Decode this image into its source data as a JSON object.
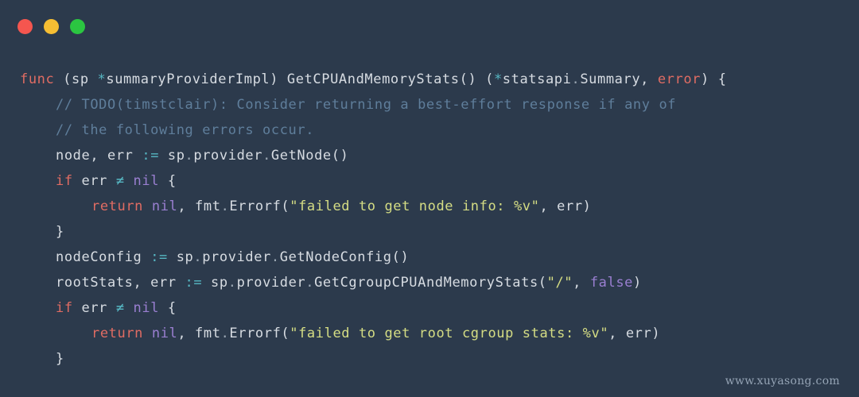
{
  "window": {
    "background_color": "#2c3a4c",
    "traffic_lights": [
      {
        "name": "close",
        "color": "#f5564f"
      },
      {
        "name": "minimize",
        "color": "#f6be33"
      },
      {
        "name": "maximize",
        "color": "#2bc641"
      }
    ]
  },
  "theme": {
    "keyword_color": "#e06c63",
    "plain_color": "#d7dce2",
    "operator_color": "#56b6c2",
    "constant_color": "#9a7fd1",
    "string_color": "#d5dd84",
    "comment_color": "#5f7e9b"
  },
  "code": {
    "language": "go",
    "lines": [
      {
        "indent": 0,
        "tokens": [
          {
            "t": "func",
            "c": "kw"
          },
          {
            "t": " (sp ",
            "c": "plain"
          },
          {
            "t": "*",
            "c": "op"
          },
          {
            "t": "summaryProviderImpl) GetCPUAndMemoryStats() (",
            "c": "plain"
          },
          {
            "t": "*",
            "c": "op"
          },
          {
            "t": "statsapi",
            "c": "plain"
          },
          {
            "t": ".",
            "c": "punct"
          },
          {
            "t": "Summary, ",
            "c": "plain"
          },
          {
            "t": "error",
            "c": "kw"
          },
          {
            "t": ") {",
            "c": "plain"
          }
        ]
      },
      {
        "indent": 1,
        "tokens": [
          {
            "t": "// TODO(timstclair): Consider returning a best-effort response if any of",
            "c": "comment"
          }
        ]
      },
      {
        "indent": 1,
        "tokens": [
          {
            "t": "// the following errors occur.",
            "c": "comment"
          }
        ]
      },
      {
        "indent": 1,
        "tokens": [
          {
            "t": "node, err ",
            "c": "plain"
          },
          {
            "t": ":=",
            "c": "op"
          },
          {
            "t": " sp",
            "c": "plain"
          },
          {
            "t": ".",
            "c": "punct"
          },
          {
            "t": "provider",
            "c": "plain"
          },
          {
            "t": ".",
            "c": "punct"
          },
          {
            "t": "GetNode()",
            "c": "plain"
          }
        ]
      },
      {
        "indent": 1,
        "tokens": [
          {
            "t": "if",
            "c": "kw"
          },
          {
            "t": " err ",
            "c": "plain"
          },
          {
            "t": "≠",
            "c": "op"
          },
          {
            "t": " ",
            "c": "plain"
          },
          {
            "t": "nil",
            "c": "const"
          },
          {
            "t": " {",
            "c": "plain"
          }
        ]
      },
      {
        "indent": 2,
        "tokens": [
          {
            "t": "return",
            "c": "kw"
          },
          {
            "t": " ",
            "c": "plain"
          },
          {
            "t": "nil",
            "c": "const"
          },
          {
            "t": ", fmt",
            "c": "plain"
          },
          {
            "t": ".",
            "c": "punct"
          },
          {
            "t": "Errorf(",
            "c": "plain"
          },
          {
            "t": "\"failed to get node info: %v\"",
            "c": "str"
          },
          {
            "t": ", err)",
            "c": "plain"
          }
        ]
      },
      {
        "indent": 1,
        "tokens": [
          {
            "t": "}",
            "c": "plain"
          }
        ]
      },
      {
        "indent": 1,
        "tokens": [
          {
            "t": "nodeConfig ",
            "c": "plain"
          },
          {
            "t": ":=",
            "c": "op"
          },
          {
            "t": " sp",
            "c": "plain"
          },
          {
            "t": ".",
            "c": "punct"
          },
          {
            "t": "provider",
            "c": "plain"
          },
          {
            "t": ".",
            "c": "punct"
          },
          {
            "t": "GetNodeConfig()",
            "c": "plain"
          }
        ]
      },
      {
        "indent": 1,
        "tokens": [
          {
            "t": "rootStats, err ",
            "c": "plain"
          },
          {
            "t": ":=",
            "c": "op"
          },
          {
            "t": " sp",
            "c": "plain"
          },
          {
            "t": ".",
            "c": "punct"
          },
          {
            "t": "provider",
            "c": "plain"
          },
          {
            "t": ".",
            "c": "punct"
          },
          {
            "t": "GetCgroupCPUAndMemoryStats(",
            "c": "plain"
          },
          {
            "t": "\"/\"",
            "c": "str"
          },
          {
            "t": ", ",
            "c": "plain"
          },
          {
            "t": "false",
            "c": "const"
          },
          {
            "t": ")",
            "c": "plain"
          }
        ]
      },
      {
        "indent": 1,
        "tokens": [
          {
            "t": "if",
            "c": "kw"
          },
          {
            "t": " err ",
            "c": "plain"
          },
          {
            "t": "≠",
            "c": "op"
          },
          {
            "t": " ",
            "c": "plain"
          },
          {
            "t": "nil",
            "c": "const"
          },
          {
            "t": " {",
            "c": "plain"
          }
        ]
      },
      {
        "indent": 2,
        "tokens": [
          {
            "t": "return",
            "c": "kw"
          },
          {
            "t": " ",
            "c": "plain"
          },
          {
            "t": "nil",
            "c": "const"
          },
          {
            "t": ", fmt",
            "c": "plain"
          },
          {
            "t": ".",
            "c": "punct"
          },
          {
            "t": "Errorf(",
            "c": "plain"
          },
          {
            "t": "\"failed to get root cgroup stats: %v\"",
            "c": "str"
          },
          {
            "t": ", err)",
            "c": "plain"
          }
        ]
      },
      {
        "indent": 1,
        "tokens": [
          {
            "t": "}",
            "c": "plain"
          }
        ]
      }
    ]
  },
  "watermark": {
    "text": "www.xuyasong.com"
  }
}
